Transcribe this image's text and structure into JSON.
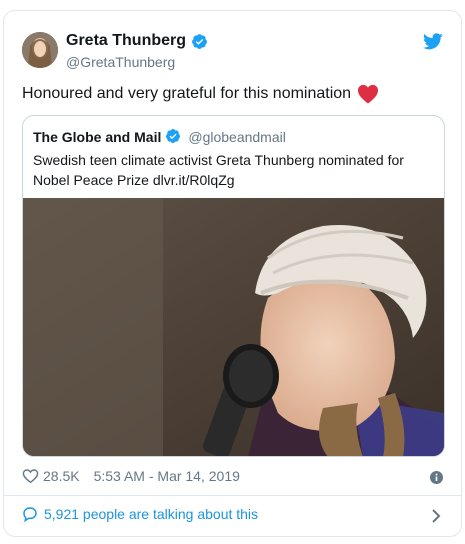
{
  "author": {
    "display_name": "Greta Thunberg",
    "handle": "@GretaThunberg"
  },
  "tweet": {
    "text": "Honoured and very grateful for this nomination",
    "emoji_icon": "red-heart-icon"
  },
  "quoted_tweet": {
    "display_name": "The Globe and Mail",
    "handle": "@globeandmail",
    "text": "Swedish teen climate activist Greta Thunberg nominated for Nobel Peace Prize dlvr.it/R0lqZg"
  },
  "footer": {
    "like_count": "28.5K",
    "timestamp": "5:53 AM - Mar 14, 2019"
  },
  "conversation": {
    "label": "5,921 people are talking about this"
  },
  "icons": {
    "platform": "twitter-bird-icon",
    "verified": "verified-badge-icon",
    "like": "heart-outline-icon",
    "info": "info-icon",
    "comment": "speech-bubble-icon",
    "chevron": "chevron-right-icon"
  },
  "colors": {
    "brand_blue": "#1da1f2",
    "link_blue": "#1b95e0",
    "heart_red": "#e0245e",
    "secondary_text": "#657786",
    "border": "#e1e8ed"
  }
}
